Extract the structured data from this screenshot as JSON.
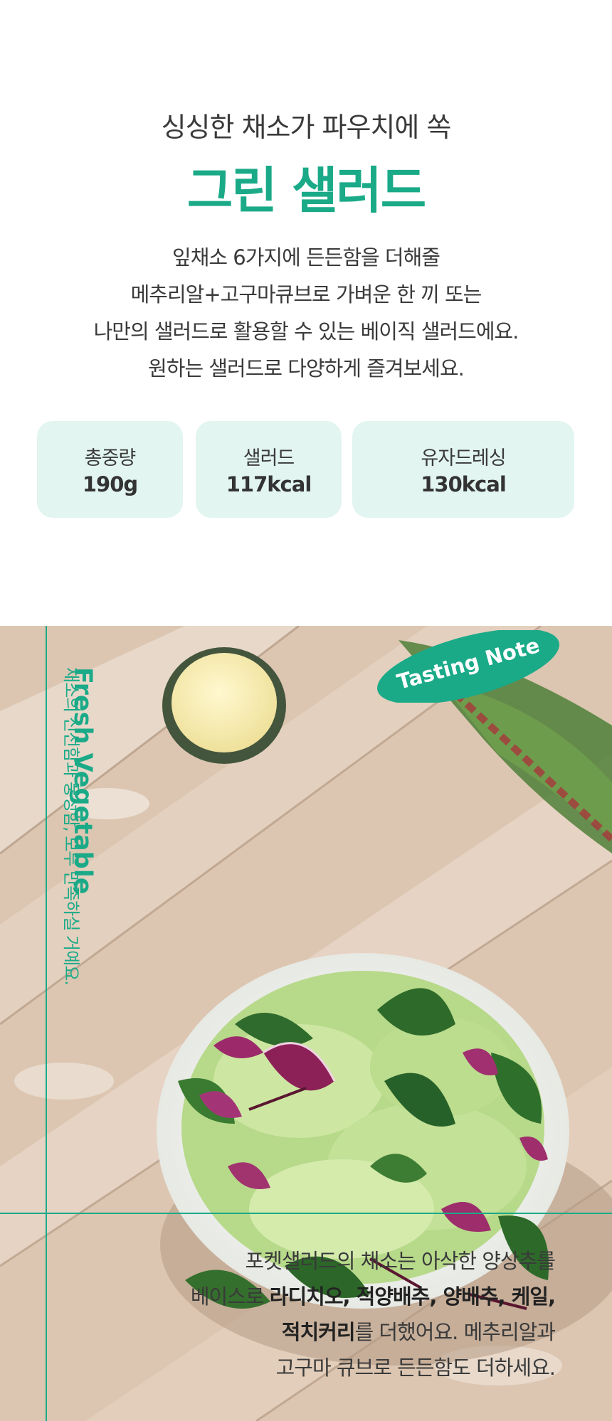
{
  "intro": {
    "subtitle": "싱싱한 채소가 파우치에 쏙",
    "title": "그린 샐러드",
    "description": [
      "잎채소 6가지에 든든함을 더해줄",
      "메추리알+고구마큐브로 가벼운 한 끼 또는",
      "나만의 샐러드로 활용할 수 있는 베이직 샐러드에요.",
      "원하는 샐러드로 다양하게 즐겨보세요."
    ]
  },
  "stats": [
    {
      "label": "총중량",
      "value": "190g"
    },
    {
      "label": "샐러드",
      "value": "117kcal"
    },
    {
      "label": "유자드레싱",
      "value": "130kcal"
    }
  ],
  "tasting": {
    "badge": "Tasting Note",
    "vertical_title": "Fresh Vegetable",
    "vertical_subtitle": "채소의 신선함과 풍성함, 모두 만족하실 거예요.",
    "lines": [
      {
        "a": "포켓샐러드의 채소는 아삭한 양상추를",
        "b": "",
        "c": ""
      },
      {
        "a": "베이스로 ",
        "b": "라디치오, 적양배추, 양배추, 케일,",
        "c": ""
      },
      {
        "a": "",
        "b": "적치커리",
        "c": "를 더했어요. 메추리알과"
      },
      {
        "a": "고구마 큐브로 든든함도 더하세요.",
        "b": "",
        "c": ""
      }
    ]
  },
  "colors": {
    "accent": "#1aaa88",
    "stat_bg": "#e2f5f0",
    "text": "#3a3a3a"
  }
}
